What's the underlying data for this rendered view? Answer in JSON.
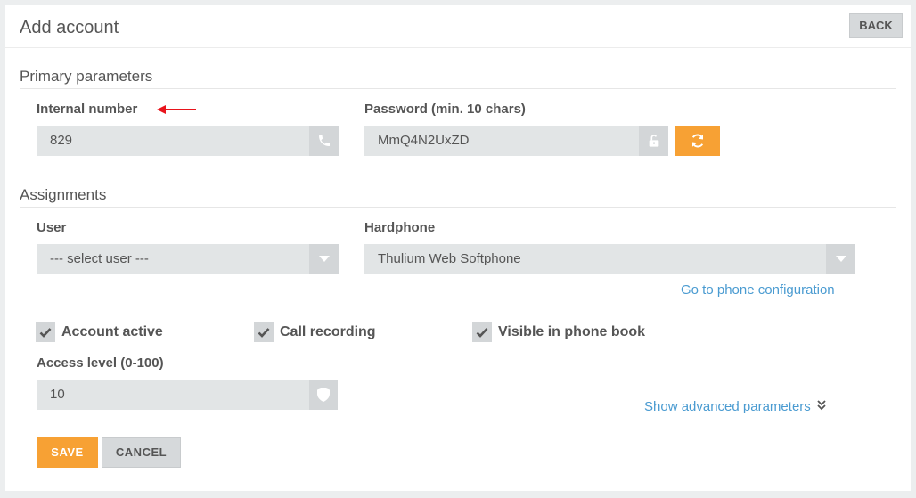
{
  "page": {
    "title": "Add account",
    "back_label": "BACK"
  },
  "primary": {
    "title": "Primary parameters",
    "internal_number_label": "Internal number",
    "internal_number_value": "829",
    "password_label": "Password (min. 10 chars)",
    "password_value": "MmQ4N2UxZD"
  },
  "assignments": {
    "title": "Assignments",
    "user_label": "User",
    "user_value": "--- select user ---",
    "hardphone_label": "Hardphone",
    "hardphone_value": "Thulium Web Softphone",
    "phone_config_link": "Go to phone configuration"
  },
  "options": {
    "account_active": "Account active",
    "call_recording": "Call recording",
    "visible_in_phone_book": "Visible in phone book"
  },
  "access": {
    "label": "Access level (0-100)",
    "value": "10"
  },
  "advanced_link": "Show advanced parameters",
  "actions": {
    "save_label": "SAVE",
    "cancel_label": "CANCEL"
  },
  "colors": {
    "accent": "#f7a134",
    "link": "#4a9bd1",
    "annotation_arrow": "#e8141c"
  }
}
